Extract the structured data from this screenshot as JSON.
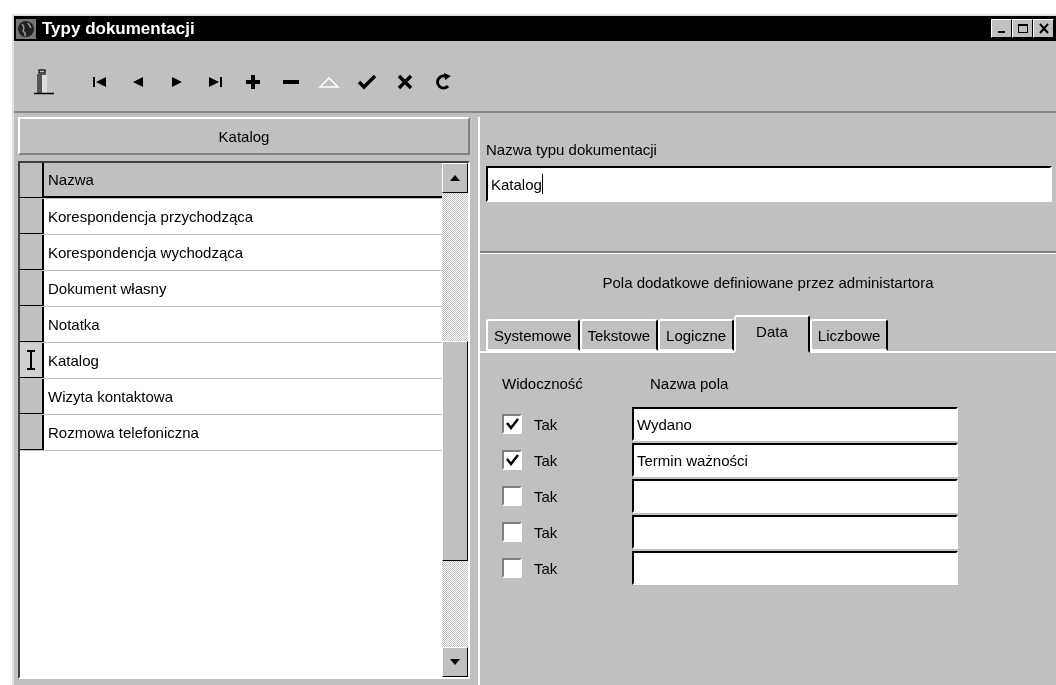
{
  "window": {
    "title": "Typy dokumentacji"
  },
  "toolbar": [
    {
      "kind": "exit",
      "disabled": false
    },
    {
      "kind": "first",
      "disabled": false
    },
    {
      "kind": "prev",
      "disabled": false
    },
    {
      "kind": "next",
      "disabled": false
    },
    {
      "kind": "last",
      "disabled": false
    },
    {
      "kind": "add",
      "disabled": false
    },
    {
      "kind": "remove",
      "disabled": false
    },
    {
      "kind": "edit",
      "disabled": true
    },
    {
      "kind": "save",
      "disabled": false
    },
    {
      "kind": "cancel",
      "disabled": false
    },
    {
      "kind": "refresh",
      "disabled": false
    }
  ],
  "list": {
    "title": "Katalog",
    "column": "Nazwa",
    "rows": [
      {
        "name": "Korespondencja przychodząca",
        "selected": false
      },
      {
        "name": "Korespondencja wychodząca",
        "selected": false
      },
      {
        "name": "Dokument własny",
        "selected": false
      },
      {
        "name": "Notatka",
        "selected": false
      },
      {
        "name": "Katalog",
        "selected": true
      },
      {
        "name": "Wizyta kontaktowa",
        "selected": false
      },
      {
        "name": "Rozmowa telefoniczna",
        "selected": false
      }
    ]
  },
  "name_field": {
    "label": "Nazwa typu dokumentacji",
    "value": "Katalog"
  },
  "extra_fields": {
    "title": "Pola dodatkowe definiowane przez administartora",
    "tabs": [
      {
        "label": "Systemowe",
        "selected": false
      },
      {
        "label": "Tekstowe",
        "selected": false
      },
      {
        "label": "Logiczne",
        "selected": false
      },
      {
        "label": "Data",
        "selected": true
      },
      {
        "label": "Liczbowe",
        "selected": false
      }
    ],
    "columns": [
      "Widoczność",
      "Nazwa pola"
    ],
    "rows": [
      {
        "checked": true,
        "label": "Tak",
        "value": "Wydano"
      },
      {
        "checked": true,
        "label": "Tak",
        "value": "Termin ważności"
      },
      {
        "checked": false,
        "label": "Tak"
      },
      {
        "checked": false,
        "label": "Tak"
      },
      {
        "checked": false,
        "label": "Tak"
      }
    ]
  }
}
